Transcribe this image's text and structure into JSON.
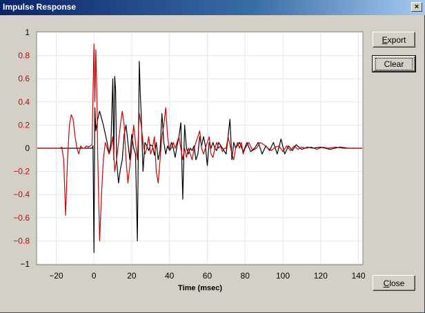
{
  "window": {
    "title": "Impulse Response",
    "close_glyph": "×"
  },
  "buttons": {
    "export_label": "Export",
    "clear_label": "Clear",
    "close_label": "Close"
  },
  "chart_data": {
    "type": "line",
    "title": "",
    "xlabel": "Time (msec)",
    "ylabel": "",
    "xlim": [
      -30,
      142
    ],
    "ylim": [
      -1,
      1
    ],
    "x_ticks": [
      -20,
      0,
      20,
      40,
      60,
      80,
      100,
      120,
      140
    ],
    "y_ticks": [
      1,
      0.8,
      0.6,
      0.4,
      0.2,
      0,
      -0.2,
      -0.4,
      -0.6,
      -0.8,
      -1
    ],
    "y_tick_colors": {
      "0": "#000000",
      "1": "#000000",
      "-1": "#000000",
      "other": "#cc0000"
    },
    "grid": true,
    "series": [
      {
        "color": "#000000",
        "points": [
          [
            -30,
            0
          ],
          [
            -1,
            0
          ],
          [
            -0.5,
            0.02
          ],
          [
            0,
            -0.9
          ],
          [
            0.5,
            0.35
          ],
          [
            1,
            0.15
          ],
          [
            2,
            0.25
          ],
          [
            3,
            0.32
          ],
          [
            5,
            0.2
          ],
          [
            7,
            0.05
          ],
          [
            8,
            -0.05
          ],
          [
            9,
            0.05
          ],
          [
            10,
            0.6
          ],
          [
            10.5,
            -0.1
          ],
          [
            11,
            0.62
          ],
          [
            11.5,
            0.5
          ],
          [
            12,
            -0.1
          ],
          [
            13,
            -0.3
          ],
          [
            14,
            -0.18
          ],
          [
            15,
            -0.1
          ],
          [
            16,
            0.12
          ],
          [
            17,
            0.2
          ],
          [
            18,
            0.05
          ],
          [
            19,
            -0.1
          ],
          [
            20,
            0.12
          ],
          [
            21,
            0.0
          ],
          [
            22,
            -0.05
          ],
          [
            23,
            -0.8
          ],
          [
            24,
            0.75
          ],
          [
            24.5,
            0.5
          ],
          [
            25,
            0.3
          ],
          [
            26,
            -0.2
          ],
          [
            27,
            0.05
          ],
          [
            28,
            0.02
          ],
          [
            29,
            -0.02
          ],
          [
            30,
            0.03
          ],
          [
            31,
            0.02
          ],
          [
            32,
            -0.06
          ],
          [
            33,
            0.05
          ],
          [
            34,
            -0.1
          ],
          [
            35,
            -0.02
          ],
          [
            36,
            0.3
          ],
          [
            37,
            0.05
          ],
          [
            38,
            -0.05
          ],
          [
            39,
            0.02
          ],
          [
            40,
            -0.02
          ],
          [
            41,
            0.05
          ],
          [
            42,
            0.0
          ],
          [
            43,
            -0.08
          ],
          [
            44,
            0.02
          ],
          [
            45,
            0.1
          ],
          [
            46,
            0.22
          ],
          [
            47,
            -0.44
          ],
          [
            48,
            0.2
          ],
          [
            49,
            0.0
          ],
          [
            50,
            -0.05
          ],
          [
            51,
            0.0
          ],
          [
            52,
            -0.02
          ],
          [
            53,
            0.02
          ],
          [
            54,
            -0.1
          ],
          [
            55,
            -0.05
          ],
          [
            56,
            0.1
          ],
          [
            57,
            0.02
          ],
          [
            58,
            0.1
          ],
          [
            59,
            0.02
          ],
          [
            60,
            -0.15
          ],
          [
            61,
            0.05
          ],
          [
            62,
            0.0
          ],
          [
            63,
            0.05
          ],
          [
            64,
            0.0
          ],
          [
            65,
            -0.02
          ],
          [
            66,
            0.05
          ],
          [
            68,
            0.0
          ],
          [
            70,
            -0.05
          ],
          [
            72,
            0.25
          ],
          [
            73,
            -0.1
          ],
          [
            74,
            0.05
          ],
          [
            75,
            0.0
          ],
          [
            77,
            0.05
          ],
          [
            79,
            -0.03
          ],
          [
            81,
            0.05
          ],
          [
            83,
            -0.03
          ],
          [
            85,
            0.0
          ],
          [
            87,
            0.05
          ],
          [
            89,
            -0.05
          ],
          [
            91,
            0.02
          ],
          [
            93,
            -0.02
          ],
          [
            95,
            0.05
          ],
          [
            97,
            -0.05
          ],
          [
            99,
            0.08
          ],
          [
            101,
            -0.05
          ],
          [
            103,
            0.02
          ],
          [
            105,
            -0.02
          ],
          [
            107,
            0.03
          ],
          [
            110,
            -0.01
          ],
          [
            113,
            0.01
          ],
          [
            116,
            0.0
          ],
          [
            120,
            0.01
          ],
          [
            125,
            -0.01
          ],
          [
            130,
            0.01
          ],
          [
            135,
            0.0
          ],
          [
            142,
            0.0
          ]
        ]
      },
      {
        "color": "#cc0000",
        "points": [
          [
            -30,
            0
          ],
          [
            -18,
            0
          ],
          [
            -17,
            0.01
          ],
          [
            -16,
            -0.1
          ],
          [
            -15,
            -0.58
          ],
          [
            -14,
            -0.1
          ],
          [
            -13,
            0.2
          ],
          [
            -12,
            0.29
          ],
          [
            -11,
            0.25
          ],
          [
            -10,
            0.1
          ],
          [
            -9,
            0.0
          ],
          [
            -8,
            -0.05
          ],
          [
            -7,
            0.02
          ],
          [
            -6,
            0.0
          ],
          [
            -5,
            0.0
          ],
          [
            -4,
            0.02
          ],
          [
            -3,
            0.01
          ],
          [
            -2,
            0.02
          ],
          [
            -1,
            0.03
          ],
          [
            0,
            0.9
          ],
          [
            0.5,
            0.4
          ],
          [
            1,
            0.85
          ],
          [
            1.5,
            0.5
          ],
          [
            2,
            -0.05
          ],
          [
            3,
            -0.8
          ],
          [
            4,
            -0.4
          ],
          [
            5,
            -0.1
          ],
          [
            6,
            0.05
          ],
          [
            7,
            0.0
          ],
          [
            8,
            -0.05
          ],
          [
            9,
            0.0
          ],
          [
            10,
            0.1
          ],
          [
            11,
            -0.2
          ],
          [
            12,
            -0.1
          ],
          [
            13,
            0.05
          ],
          [
            14,
            0.2
          ],
          [
            15,
            0.32
          ],
          [
            16,
            0.2
          ],
          [
            17,
            -0.1
          ],
          [
            18,
            -0.3
          ],
          [
            19,
            -0.15
          ],
          [
            20,
            0.0
          ],
          [
            21,
            0.2
          ],
          [
            22,
            0.05
          ],
          [
            23,
            -0.1
          ],
          [
            24,
            0.3
          ],
          [
            25,
            0.2
          ],
          [
            26,
            0.05
          ],
          [
            27,
            -0.05
          ],
          [
            28,
            0.0
          ],
          [
            29,
            0.1
          ],
          [
            30,
            -0.05
          ],
          [
            31,
            0.0
          ],
          [
            32,
            0.1
          ],
          [
            33,
            -0.2
          ],
          [
            34,
            -0.3
          ],
          [
            35,
            -0.1
          ],
          [
            36,
            0.1
          ],
          [
            37,
            0.2
          ],
          [
            38,
            0.35
          ],
          [
            39,
            0.1
          ],
          [
            40,
            -0.02
          ],
          [
            41,
            0.0
          ],
          [
            42,
            0.05
          ],
          [
            43,
            0.0
          ],
          [
            44,
            0.05
          ],
          [
            45,
            0.1
          ],
          [
            46,
            0.0
          ],
          [
            47,
            -0.1
          ],
          [
            48,
            0.0
          ],
          [
            49,
            -0.08
          ],
          [
            50,
            0.0
          ],
          [
            51,
            -0.05
          ],
          [
            52,
            -0.1
          ],
          [
            53,
            0.0
          ],
          [
            54,
            0.05
          ],
          [
            55,
            0.1
          ],
          [
            56,
            0.15
          ],
          [
            57,
            0.0
          ],
          [
            58,
            -0.05
          ],
          [
            59,
            0.0
          ],
          [
            60,
            0.05
          ],
          [
            61,
            0.1
          ],
          [
            62,
            -0.05
          ],
          [
            63,
            -0.08
          ],
          [
            64,
            0.0
          ],
          [
            65,
            0.05
          ],
          [
            66,
            0.0
          ],
          [
            67,
            0.02
          ],
          [
            68,
            -0.03
          ],
          [
            69,
            0.0
          ],
          [
            70,
            0.0
          ],
          [
            71,
            0.1
          ],
          [
            72,
            0.03
          ],
          [
            73,
            -0.05
          ],
          [
            74,
            -0.1
          ],
          [
            75,
            0.0
          ],
          [
            76,
            0.05
          ],
          [
            77,
            0.0
          ],
          [
            78,
            0.05
          ],
          [
            79,
            -0.05
          ],
          [
            80,
            0.0
          ],
          [
            82,
            0.05
          ],
          [
            84,
            -0.02
          ],
          [
            86,
            0.0
          ],
          [
            88,
            0.05
          ],
          [
            90,
            0.03
          ],
          [
            92,
            0.0
          ],
          [
            94,
            -0.02
          ],
          [
            96,
            0.01
          ],
          [
            98,
            0.02
          ],
          [
            100,
            -0.03
          ],
          [
            102,
            0.02
          ],
          [
            104,
            -0.02
          ],
          [
            106,
            0.02
          ],
          [
            108,
            -0.01
          ],
          [
            110,
            0.01
          ],
          [
            112,
            0.0
          ],
          [
            115,
            0.01
          ],
          [
            118,
            -0.01
          ],
          [
            121,
            0.01
          ],
          [
            124,
            0.0
          ],
          [
            128,
            0.01
          ],
          [
            132,
            0.0
          ],
          [
            136,
            0.0
          ],
          [
            142,
            0.0
          ]
        ]
      }
    ]
  }
}
